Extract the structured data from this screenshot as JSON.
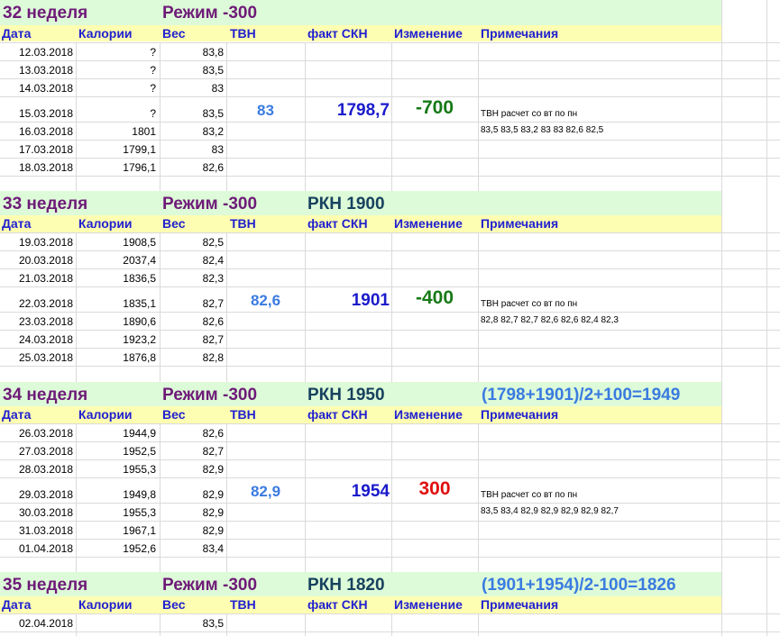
{
  "columns": [
    "Дата",
    "Калории",
    "Вес",
    "ТВН",
    "факт СКН",
    "Изменение",
    "Примечания"
  ],
  "weeks": [
    {
      "week": "32  неделя",
      "mode": "Режим -300",
      "rkn": "",
      "formula": "",
      "rows": [
        {
          "date": "12.03.2018",
          "cal": "?",
          "weight": "83,8"
        },
        {
          "date": "13.03.2018",
          "cal": "?",
          "weight": "83,5"
        },
        {
          "date": "14.03.2018",
          "cal": "?",
          "weight": "83"
        },
        {
          "date": "15.03.2018",
          "cal": "?",
          "weight": "83,5"
        },
        {
          "date": "16.03.2018",
          "cal": "1801",
          "weight": "83,2"
        },
        {
          "date": "17.03.2018",
          "cal": "1799,1",
          "weight": "83"
        },
        {
          "date": "18.03.2018",
          "cal": "1796,1",
          "weight": "82,6"
        }
      ],
      "tvn": "83",
      "fact_skn": "1798,7",
      "change": "-700",
      "change_color": "#177a17",
      "note1": "ТВН расчет со вт по пн",
      "note2": "83,5  83,5  83,2  83  83  82,6  82,5"
    },
    {
      "week": "33  неделя",
      "mode": "Режим -300",
      "rkn": "РКН 1900",
      "formula": "",
      "rows": [
        {
          "date": "19.03.2018",
          "cal": "1908,5",
          "weight": "82,5"
        },
        {
          "date": "20.03.2018",
          "cal": "2037,4",
          "weight": "82,4"
        },
        {
          "date": "21.03.2018",
          "cal": "1836,5",
          "weight": "82,3"
        },
        {
          "date": "22.03.2018",
          "cal": "1835,1",
          "weight": "82,7"
        },
        {
          "date": "23.03.2018",
          "cal": "1890,6",
          "weight": "82,6"
        },
        {
          "date": "24.03.2018",
          "cal": "1923,2",
          "weight": "82,7"
        },
        {
          "date": "25.03.2018",
          "cal": "1876,8",
          "weight": "82,8"
        }
      ],
      "tvn": "82,6",
      "fact_skn": "1901",
      "change": "-400",
      "change_color": "#177a17",
      "note1": "ТВН расчет со вт по пн",
      "note2": "82,8  82,7  82,7  82,6  82,6  82,4  82,3"
    },
    {
      "week": "34  неделя",
      "mode": "Режим -300",
      "rkn": "РКН 1950",
      "formula": "(1798+1901)/2+100=1949",
      "rows": [
        {
          "date": "26.03.2018",
          "cal": "1944,9",
          "weight": "82,6"
        },
        {
          "date": "27.03.2018",
          "cal": "1952,5",
          "weight": "82,7"
        },
        {
          "date": "28.03.2018",
          "cal": "1955,3",
          "weight": "82,9"
        },
        {
          "date": "29.03.2018",
          "cal": "1949,8",
          "weight": "82,9"
        },
        {
          "date": "30.03.2018",
          "cal": "1955,3",
          "weight": "82,9"
        },
        {
          "date": "31.03.2018",
          "cal": "1967,1",
          "weight": "82,9"
        },
        {
          "date": "01.04.2018",
          "cal": "1952,6",
          "weight": "83,4"
        }
      ],
      "tvn": "82,9",
      "fact_skn": "1954",
      "change": "300",
      "change_color": "#e01010",
      "note1": "ТВН расчет со вт по пн",
      "note2": "83,5  83,4  82,9  82,9  82,9  82,9  82,7"
    },
    {
      "week": "35  неделя",
      "mode": "Режим -300",
      "rkn": "РКН 1820",
      "formula": "(1901+1954)/2-100=1826",
      "rows": [
        {
          "date": "02.04.2018",
          "cal": "",
          "weight": "83,5"
        }
      ],
      "tvn": "",
      "fact_skn": "",
      "change": "",
      "change_color": "#177a17",
      "note1": "",
      "note2": ""
    }
  ]
}
